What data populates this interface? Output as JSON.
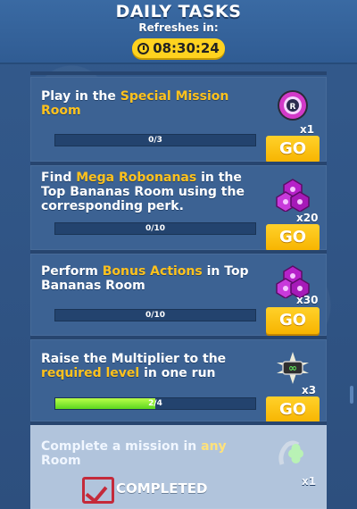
{
  "header": {
    "title": "DAILY TASKS",
    "subtitle": "Refreshes in:",
    "timer": "08:30:24"
  },
  "tasks": [
    {
      "text_parts": [
        "Play in the ",
        "Special Mission Room",
        ""
      ],
      "progress_label": "0/3",
      "progress_fraction": 0,
      "reward_icon": "mission-badge-icon",
      "reward_count": "x1",
      "action": "GO"
    },
    {
      "text_parts": [
        "Find ",
        "Mega Robonanas",
        " in the Top Bananas Room using the corresponding perk."
      ],
      "progress_label": "0/10",
      "progress_fraction": 0,
      "reward_icon": "purple-gems-icon",
      "reward_count": "x20",
      "action": "GO"
    },
    {
      "text_parts": [
        "Perform ",
        "Bonus Actions",
        " in Top Bananas Room"
      ],
      "progress_label": "0/10",
      "progress_fraction": 0,
      "reward_icon": "purple-gems-icon",
      "reward_count": "x30",
      "action": "GO"
    },
    {
      "text_parts": [
        "Raise the Multiplier to the ",
        "required level",
        " in one run"
      ],
      "progress_label": "2/4",
      "progress_fraction": 0.5,
      "reward_icon": "infinity-token-icon",
      "reward_count": "x3",
      "action": "GO"
    },
    {
      "text_parts": [
        "Complete a mission in ",
        "any",
        " Room"
      ],
      "status": "COMPLETED",
      "reward_icon": "green-clover-icon",
      "reward_count": "x1"
    }
  ],
  "colors": {
    "accent_yellow": "#ffc21d",
    "go_button": "#f7b400",
    "progress_green": "#5cd61f",
    "card_blue": "#3c6293"
  }
}
